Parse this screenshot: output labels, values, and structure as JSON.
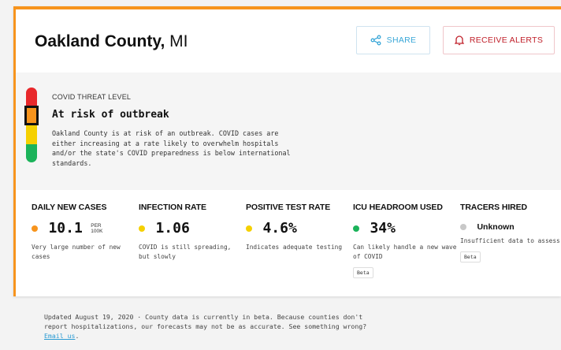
{
  "header": {
    "county": "Oakland County,",
    "state": "MI",
    "share_label": "SHARE",
    "alerts_label": "RECEIVE ALERTS"
  },
  "threat": {
    "label": "COVID THREAT LEVEL",
    "title": "At risk of outbreak",
    "description": "Oakland County is at risk of an outbreak. COVID cases are either increasing at a rate likely to overwhelm hospitals and/or the state's COVID preparedness is below international standards.",
    "level": "orange",
    "colors": {
      "red": "#e8282b",
      "orange": "#f7941d",
      "yellow": "#f5d000",
      "green": "#1bb35a"
    }
  },
  "metrics": [
    {
      "label": "DAILY NEW CASES",
      "value": "10.1",
      "unit_top": "PER",
      "unit_bottom": "100K",
      "status_color": "#f7941d",
      "description": "Very large number of new cases"
    },
    {
      "label": "INFECTION RATE",
      "value": "1.06",
      "status_color": "#f5d000",
      "description": "COVID is still spreading, but slowly"
    },
    {
      "label": "POSITIVE TEST RATE",
      "value": "4.6%",
      "status_color": "#f5d000",
      "description": "Indicates adequate testing"
    },
    {
      "label": "ICU HEADROOM USED",
      "value": "34%",
      "status_color": "#1bb35a",
      "description": "Can likely handle a new wave of COVID",
      "badge": "Beta"
    },
    {
      "label": "TRACERS HIRED",
      "value": "Unknown",
      "status_color": "#c8c8c8",
      "description": "Insufficient data to assess",
      "badge": "Beta"
    }
  ],
  "footer": {
    "text": "Updated August 19, 2020 · County data is currently in beta. Because counties don't report hospitalizations, our forecasts may not be as accurate. See something wrong?",
    "link_text": "Email us",
    "suffix": "."
  },
  "icons": {
    "share": "share-icon",
    "alerts": "bell-icon"
  }
}
